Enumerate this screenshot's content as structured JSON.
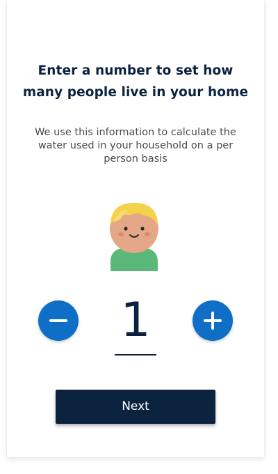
{
  "header": {
    "title_line1": "Enter a number to set how",
    "title_line2": "many people live in your home"
  },
  "description": {
    "line1": "We use this information to calculate the",
    "line2": "water used in your household on a per",
    "line3": "person basis"
  },
  "stepper": {
    "value": "1",
    "decrement_icon": "minus-icon",
    "increment_icon": "plus-icon"
  },
  "actions": {
    "next_label": "Next"
  },
  "colors": {
    "primary_navy": "#0c2340",
    "stepper_blue": "#0f6fc6",
    "body_text": "#4a4a4a"
  }
}
